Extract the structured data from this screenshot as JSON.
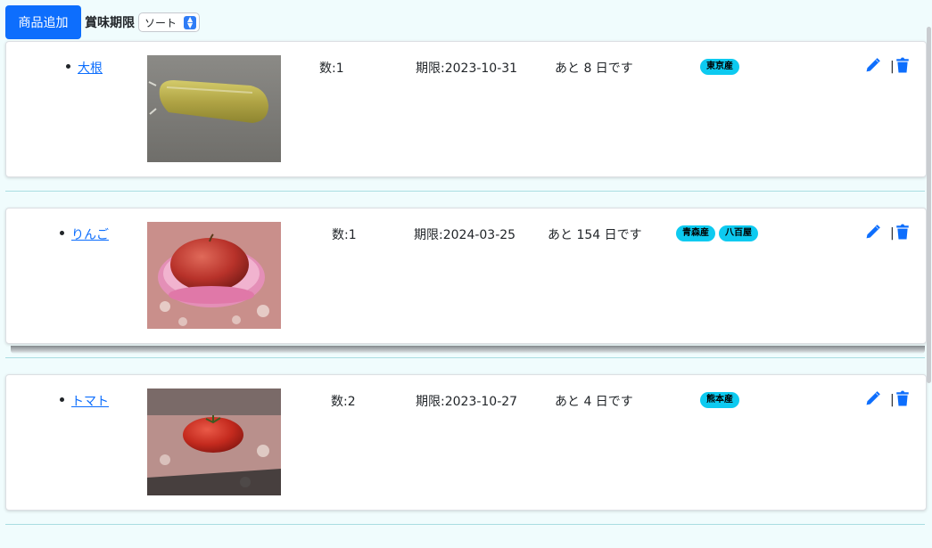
{
  "toolbar": {
    "add_label": "商品追加",
    "sort_label": "賞味期限",
    "sort_select": "ソート"
  },
  "items": [
    {
      "name": "大根",
      "qty": "数:1",
      "expiry": "期限:2023-10-31",
      "remaining": "あと 8 日です",
      "tags": [
        "東京産"
      ]
    },
    {
      "name": "りんご",
      "qty": "数:1",
      "expiry": "期限:2024-03-25",
      "remaining": "あと 154 日です",
      "tags": [
        "青森産",
        "八百屋"
      ]
    },
    {
      "name": "トマト",
      "qty": "数:2",
      "expiry": "期限:2023-10-27",
      "remaining": "あと 4 日です",
      "tags": [
        "熊本産"
      ]
    }
  ],
  "icons": {
    "edit": "pencil-icon",
    "delete": "trash-icon",
    "separator": "|"
  },
  "colors": {
    "primary": "#0d6efd",
    "tag": "#0dcaf0",
    "background": "#f0fcfd"
  }
}
